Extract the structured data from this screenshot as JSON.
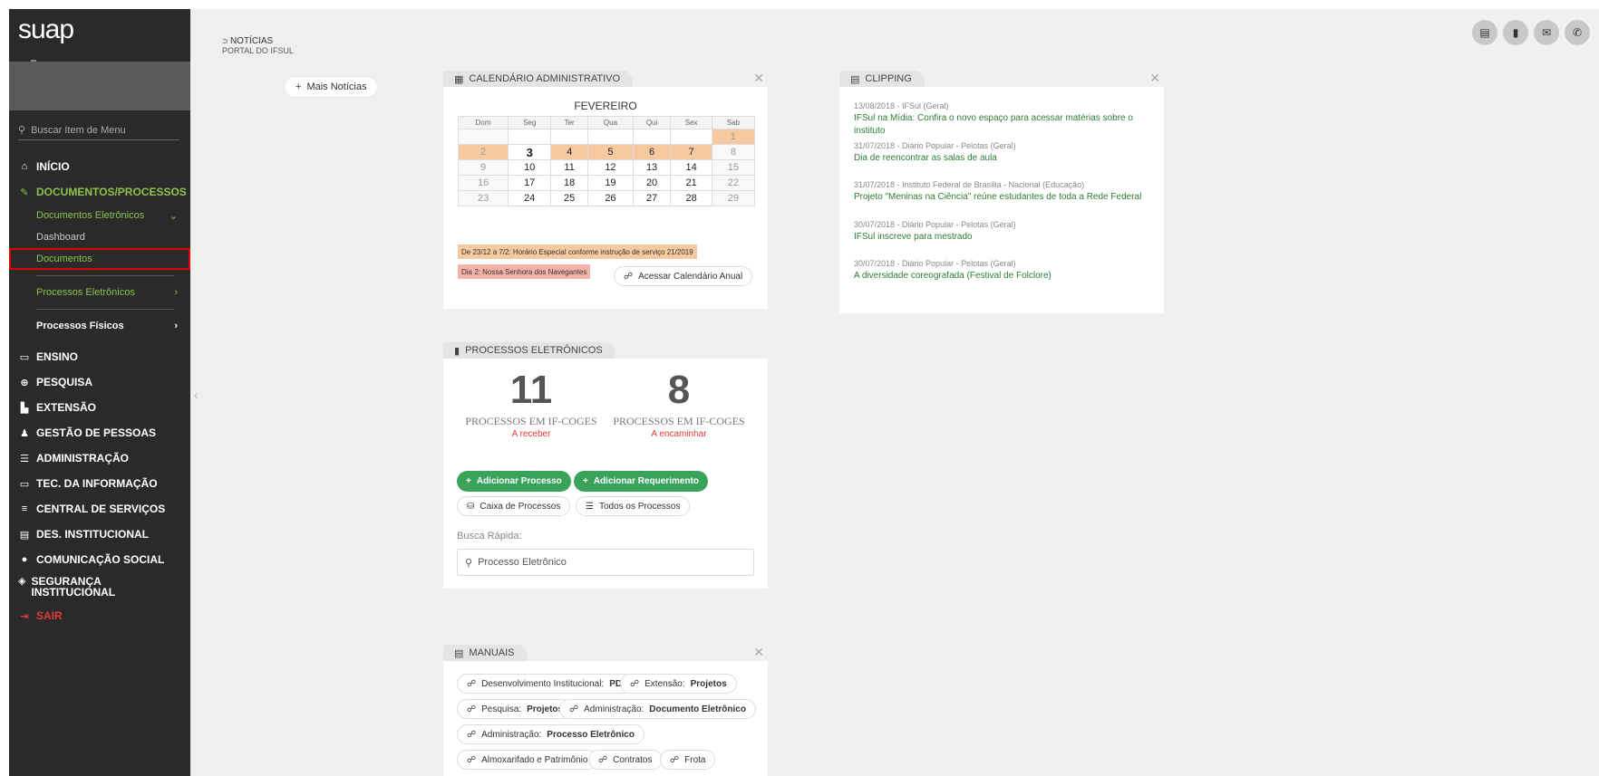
{
  "app": {
    "logo": "suap"
  },
  "sidebar": {
    "search_placeholder": "Buscar Item de Menu",
    "items": [
      {
        "icon": "home-icon",
        "glyph": "⌂",
        "label": "INÍCIO"
      },
      {
        "icon": "docs-icon",
        "glyph": "✎",
        "label": "DOCUMENTOS/PROCESSOS"
      },
      {
        "icon": "ensino-icon",
        "glyph": "▭",
        "label": "ENSINO"
      },
      {
        "icon": "globe-icon",
        "glyph": "⊕",
        "label": "PESQUISA"
      },
      {
        "icon": "briefcase-icon",
        "glyph": "▙",
        "label": "EXTENSÃO"
      },
      {
        "icon": "users-icon",
        "glyph": "♟",
        "label": "GESTÃO DE PESSOAS"
      },
      {
        "icon": "list-icon",
        "glyph": "☰",
        "label": "ADMINISTRAÇÃO"
      },
      {
        "icon": "laptop-icon",
        "glyph": "▭",
        "label": "TEC. DA INFORMAÇÃO"
      },
      {
        "icon": "bars-icon",
        "glyph": "≡",
        "label": "CENTRAL DE SERVIÇOS"
      },
      {
        "icon": "chart-icon",
        "glyph": "▤",
        "label": "DES. INSTITUCIONAL"
      },
      {
        "icon": "comment-icon",
        "glyph": "●",
        "label": "COMUNICAÇÃO SOCIAL"
      },
      {
        "icon": "shield-icon",
        "glyph": "◈",
        "label": "SEGURANÇA INSTITUCIONAL"
      },
      {
        "icon": "signout-icon",
        "glyph": "⇥",
        "label": "SAIR"
      }
    ],
    "sub": {
      "docs_eletronicos": "Documentos Eletrônicos",
      "dashboard": "Dashboard",
      "documentos": "Documentos",
      "proc_eletronicos": "Processos Eletrônicos",
      "proc_fisicos": "Processos Físicos"
    }
  },
  "news": {
    "title": "NOTÍCIAS",
    "subtitle": "PORTAL DO IFSUL",
    "more_label": "Mais Notícias"
  },
  "calendar": {
    "tab": "CALENDÁRIO ADMINISTRATIVO",
    "month": "FEVEREIRO",
    "days": [
      "Dom",
      "Seg",
      "Ter",
      "Qua",
      "Qui",
      "Sex",
      "Sab"
    ],
    "weeks": [
      [
        "",
        "",
        "",
        "",
        "",
        "",
        "1"
      ],
      [
        "2",
        "3",
        "4",
        "5",
        "6",
        "7",
        "8"
      ],
      [
        "9",
        "10",
        "11",
        "12",
        "13",
        "14",
        "15"
      ],
      [
        "16",
        "17",
        "18",
        "19",
        "20",
        "21",
        "22"
      ],
      [
        "23",
        "24",
        "25",
        "26",
        "27",
        "28",
        "29"
      ]
    ],
    "legend1": "De 23/12 a 7/2: Horário Especial conforme instrução de serviço 21/2019",
    "legend2": "Dia 2: Nossa Senhora dos Navegantes",
    "annual_label": "Acessar Calendário Anual"
  },
  "processos": {
    "tab": "PROCESSOS ELETRÔNICOS",
    "left_num": "11",
    "left_label": "PROCESSOS EM IF-COGES",
    "left_sub": "A receber",
    "right_num": "8",
    "right_label": "PROCESSOS EM IF-COGES",
    "right_sub": "A encaminhar",
    "add_processo": "Adicionar Processo",
    "add_requerimento": "Adicionar Requerimento",
    "caixa": "Caixa de Processos",
    "todos": "Todos os Processos",
    "busca_label": "Busca Rápida:",
    "busca_placeholder": "Processo Eletrônico"
  },
  "manuais": {
    "tab": "MANUAIS",
    "links": [
      {
        "pre": "Desenvolvimento Institucional: ",
        "bold": "PDI"
      },
      {
        "pre": "Extensão: ",
        "bold": "Projetos"
      },
      {
        "pre": "Pesquisa: ",
        "bold": "Projetos"
      },
      {
        "pre": "Administração: ",
        "bold": "Documento Eletrônico"
      },
      {
        "pre": "Administração: ",
        "bold": "Processo Eletrônico"
      },
      {
        "pre": "Almoxarifado e Patrimônio",
        "bold": ""
      },
      {
        "pre": "Contratos",
        "bold": ""
      },
      {
        "pre": "Frota",
        "bold": ""
      }
    ]
  },
  "clipping": {
    "tab": "CLIPPING",
    "items": [
      {
        "date": "13/08/2018 - IFSul (Geral)",
        "title": "IFSul na Mídia: Confira o novo espaço para acessar matérias sobre o instituto"
      },
      {
        "date": "31/07/2018 - Diário Popular - Pelotas (Geral)",
        "title": "Dia de reencontrar as salas de aula"
      },
      {
        "date": "31/07/2018 - Instituto Federal de Brasília - Nacional (Educação)",
        "title": "Projeto \"Meninas na Ciência\" reúne estudantes de toda a Rede Federal"
      },
      {
        "date": "30/07/2018 - Diário Popular - Pelotas (Geral)",
        "title": "IFSul inscreve para mestrado"
      },
      {
        "date": "30/07/2018 - Diário Popular - Pelotas (Geral)",
        "title": "A diversidade coreografada (Festival de Folclore)"
      }
    ]
  },
  "colors": {
    "accent_green": "#8bc34a",
    "button_green": "#3aa35b",
    "highlight": "#f6c9a0",
    "danger": "#e53935"
  }
}
